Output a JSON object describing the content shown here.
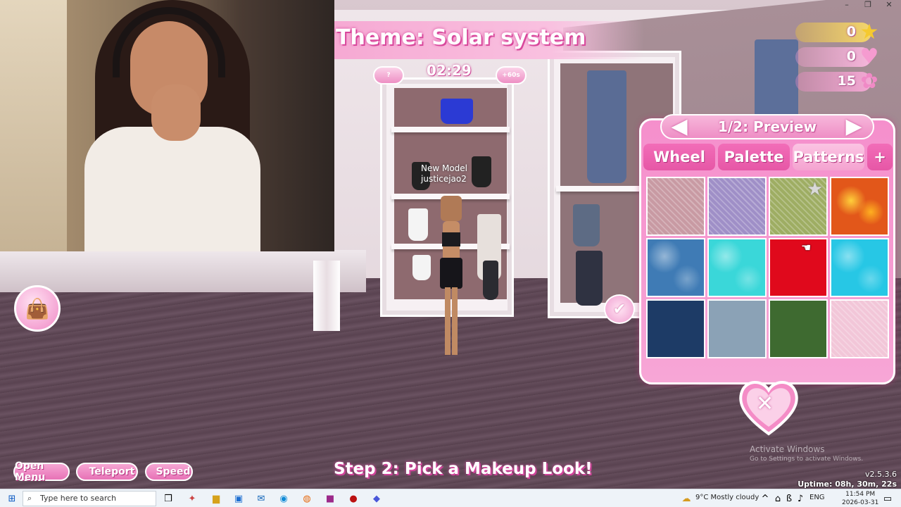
{
  "window": {
    "controls": [
      "–",
      "❐",
      "✕"
    ]
  },
  "hud": {
    "theme_title": "Theme: Solar system",
    "timer": "02:29",
    "time_bonus": "+60s",
    "nameplate_line1": "New Model",
    "nameplate_line2": "justicejao2",
    "currencies": [
      {
        "value": "0",
        "icon": "star-icon",
        "color": "#f5c92f"
      },
      {
        "value": "0",
        "icon": "heart-badge-icon",
        "color": "#f59bd0"
      },
      {
        "value": "15",
        "icon": "bow-icon",
        "color": "#f08ac6"
      }
    ],
    "step_text": "Step 2: Pick a Makeup Look!",
    "buttons": {
      "open_menu": "Open Menu",
      "teleport": "Teleport",
      "speed": "Speed"
    }
  },
  "panel": {
    "page_label": "1/2: Preview",
    "prev_arrow": "◀",
    "next_arrow": "▶",
    "tabs": [
      {
        "label": "Wheel",
        "active": false
      },
      {
        "label": "Palette",
        "active": false
      },
      {
        "label": "Patterns",
        "active": true
      },
      {
        "label": "+",
        "active": false
      }
    ],
    "patterns": [
      {
        "name": "pink-plaid",
        "color": "#c89aa3"
      },
      {
        "name": "purple-plaid",
        "color": "#9f8fc7"
      },
      {
        "name": "olive-plaid",
        "color": "#9ead63"
      },
      {
        "name": "lava",
        "color": "#e2571a"
      },
      {
        "name": "blue-water",
        "color": "#3f7bb5"
      },
      {
        "name": "aqua-water",
        "color": "#3ad7d9"
      },
      {
        "name": "red-texture",
        "color": "#e0091c"
      },
      {
        "name": "cyan-water",
        "color": "#27c7e5"
      },
      {
        "name": "navy",
        "color": "#1d3b66"
      },
      {
        "name": "denim",
        "color": "#8ba2b6"
      },
      {
        "name": "green-texture",
        "color": "#3e6a30"
      },
      {
        "name": "pink-gingham",
        "color": "#f2c6d8"
      }
    ],
    "close_icon": "✕"
  },
  "watermark": {
    "title": "Activate Windows",
    "subtitle": "Go to Settings to activate Windows."
  },
  "version": {
    "number": "v2.5.3.6",
    "uptime": "Uptime: 08h, 30m, 22s"
  },
  "taskbar": {
    "search_placeholder": "Type here to search",
    "weather": "9°C  Mostly cloudy",
    "language": "ENG",
    "time": "11:54 PM",
    "date": "2026-03-31"
  }
}
